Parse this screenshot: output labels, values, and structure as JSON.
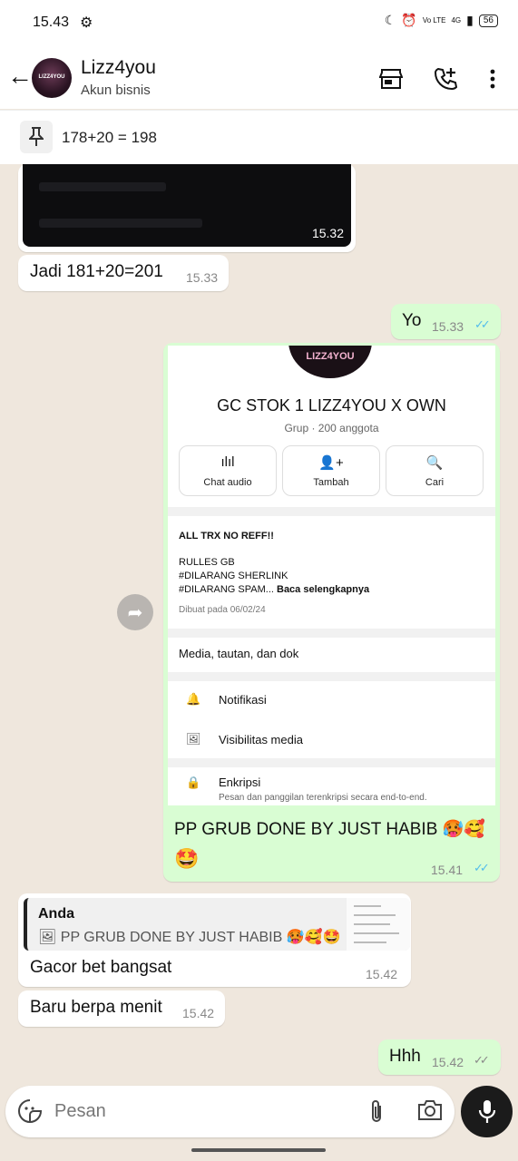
{
  "status_bar": {
    "time": "15.43",
    "network": "Vo LTE",
    "signal": "4G",
    "battery": "56"
  },
  "header": {
    "name": "Lizz4you",
    "subtitle": "Akun bisnis",
    "avatar_text": "LIZZ4YOU"
  },
  "pinned": {
    "text": "178+20 = 198"
  },
  "messages": {
    "m1": {
      "time": "15.32"
    },
    "m2": {
      "text": "Jadi 181+20=201",
      "time": "15.33"
    },
    "m3": {
      "text": "Yo",
      "time": "15.33",
      "read": true
    },
    "m4": {
      "caption_line1": "PP GRUB DONE BY JUST HABIB 🥵🥰",
      "caption_line2": "🤩",
      "time": "15.41",
      "read": true,
      "screenshot": {
        "logo_text": "LIZZ4YOU",
        "title": "GC STOK 1 LIZZ4YOU X OWN",
        "subtitle": "Grup · 200 anggota",
        "buttons": [
          {
            "icon": "audio-wave-icon",
            "label": "Chat audio"
          },
          {
            "icon": "add-person-icon",
            "label": "Tambah"
          },
          {
            "icon": "search-icon",
            "label": "Cari"
          }
        ],
        "desc_line1": "ALL TRX NO REFF!!",
        "desc_line2": "RULLES GB",
        "desc_line3": "#DILARANG SHERLINK",
        "desc_line4": "#DILARANG SPAM...",
        "desc_more": "Baca selengkapnya",
        "created": "Dibuat pada 06/02/24",
        "media": "Media, tautan, dan dok",
        "notif": "Notifikasi",
        "visibility": "Visibilitas media",
        "encrypt": "Enkripsi",
        "encrypt_sub": "Pesan dan panggilan terenkripsi secara end-to-end."
      }
    },
    "m5": {
      "quote_name": "Anda",
      "quote_text": "PP GRUB DONE BY JUST HABIB 🥵🥰🤩",
      "text": "Gacor bet bangsat",
      "time": "15.42"
    },
    "m6": {
      "text": "Baru berpa menit",
      "time": "15.42"
    },
    "m7": {
      "text": "Hhh",
      "time": "15.42",
      "read": false
    }
  },
  "composer": {
    "placeholder": "Pesan"
  },
  "colors": {
    "incoming": "#ffffff",
    "outgoing": "#d9fdd3",
    "background": "#efe7dd",
    "read_tick": "#53bdeb"
  }
}
